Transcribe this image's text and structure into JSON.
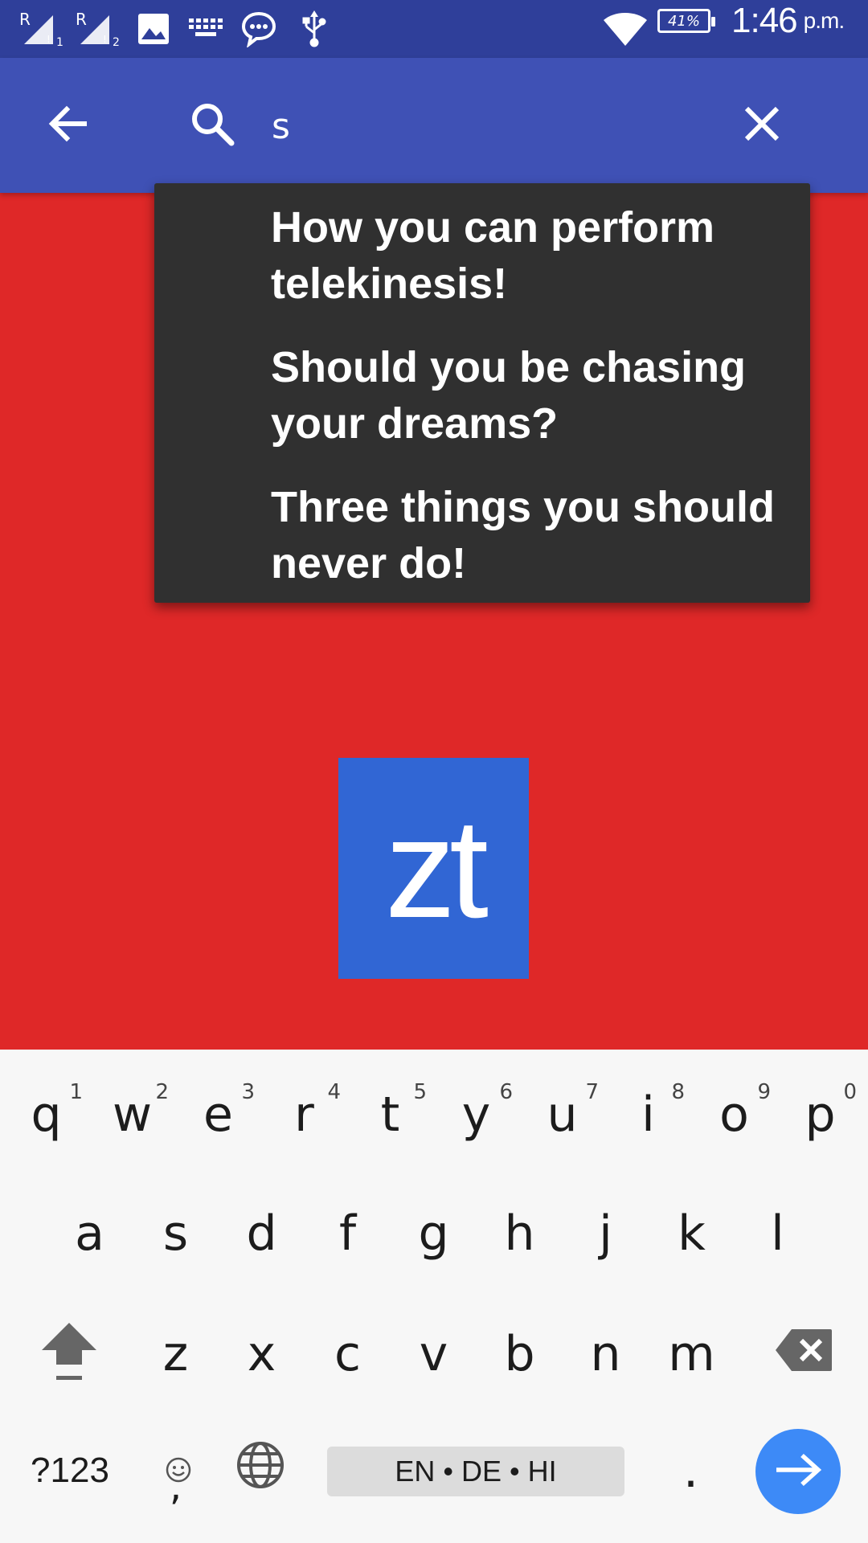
{
  "status_bar": {
    "time": "1:46",
    "ampm": "p.m.",
    "battery": "41%",
    "sim1_label": "R",
    "sim2_label": "R"
  },
  "search": {
    "query": "s",
    "back_icon": "arrow-back-icon",
    "search_icon": "search-icon",
    "clear_icon": "close-icon"
  },
  "suggestions": [
    "How you can perform telekinesis!",
    "Should you be chasing your dreams?",
    "Three things you should never do!"
  ],
  "logo": {
    "text": "zt"
  },
  "keyboard": {
    "row1": [
      {
        "key": "q",
        "hint": "1"
      },
      {
        "key": "w",
        "hint": "2"
      },
      {
        "key": "e",
        "hint": "3"
      },
      {
        "key": "r",
        "hint": "4"
      },
      {
        "key": "t",
        "hint": "5"
      },
      {
        "key": "y",
        "hint": "6"
      },
      {
        "key": "u",
        "hint": "7"
      },
      {
        "key": "i",
        "hint": "8"
      },
      {
        "key": "o",
        "hint": "9"
      },
      {
        "key": "p",
        "hint": "0"
      }
    ],
    "row2": [
      "a",
      "s",
      "d",
      "f",
      "g",
      "h",
      "j",
      "k",
      "l"
    ],
    "row3": [
      "z",
      "x",
      "c",
      "v",
      "b",
      "n",
      "m"
    ],
    "symbols_label": "?123",
    "comma_label": ",",
    "period_label": ".",
    "space_label": "EN • DE • HI"
  },
  "colors": {
    "status_bar": "#2f3f9a",
    "app_bar": "#3f51b5",
    "background": "#df2828",
    "logo_bg": "#3166d4",
    "enter_key": "#3d8af7"
  }
}
